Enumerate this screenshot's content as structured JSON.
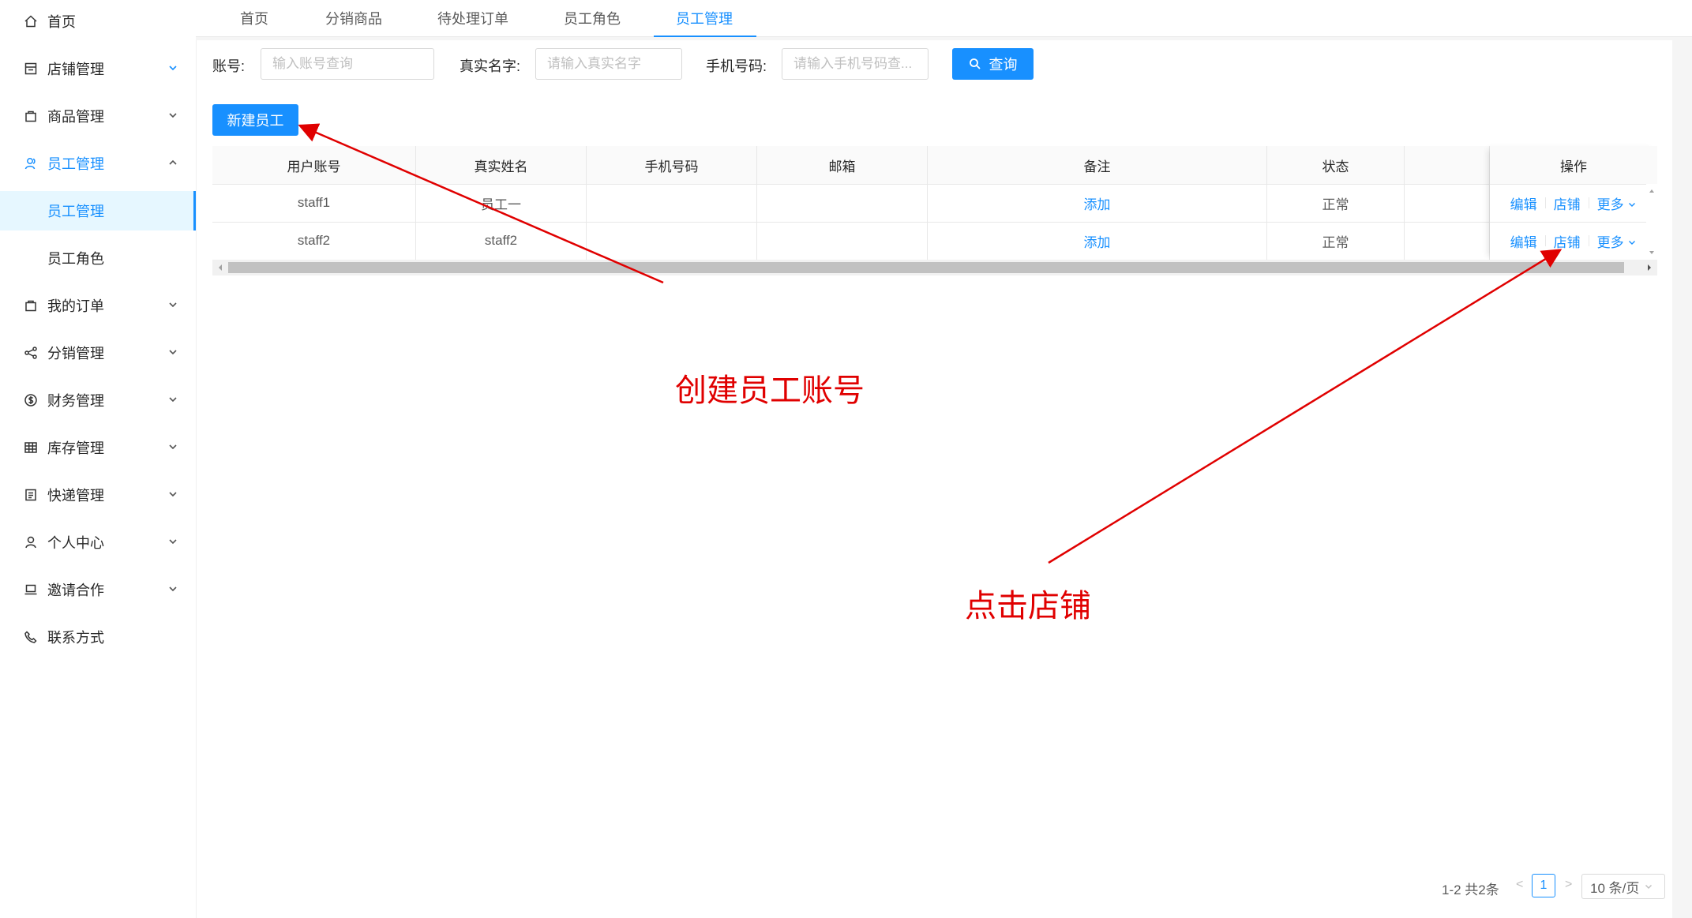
{
  "sidebar": {
    "items": [
      {
        "label": "首页",
        "icon": "home-icon",
        "type": "top",
        "expandable": false
      },
      {
        "label": "店铺管理",
        "icon": "store-icon",
        "type": "top",
        "expandable": true,
        "chevron": "down",
        "chevron_color": "#1890ff"
      },
      {
        "label": "商品管理",
        "icon": "shopping-bag-icon",
        "type": "top",
        "expandable": true,
        "chevron": "down"
      },
      {
        "label": "员工管理",
        "icon": "team-icon",
        "type": "top",
        "expandable": true,
        "chevron": "up",
        "open": true
      },
      {
        "label": "员工管理",
        "type": "sub",
        "active": true
      },
      {
        "label": "员工角色",
        "type": "sub"
      },
      {
        "label": "我的订单",
        "icon": "shopping-bag-icon",
        "type": "top",
        "expandable": true,
        "chevron": "down"
      },
      {
        "label": "分销管理",
        "icon": "share-icon",
        "type": "top",
        "expandable": true,
        "chevron": "down"
      },
      {
        "label": "财务管理",
        "icon": "dollar-icon",
        "type": "top",
        "expandable": true,
        "chevron": "down"
      },
      {
        "label": "库存管理",
        "icon": "table-icon",
        "type": "top",
        "expandable": true,
        "chevron": "down"
      },
      {
        "label": "快递管理",
        "icon": "list-icon",
        "type": "top",
        "expandable": true,
        "chevron": "down"
      },
      {
        "label": "个人中心",
        "icon": "user-icon",
        "type": "top",
        "expandable": true,
        "chevron": "down"
      },
      {
        "label": "邀请合作",
        "icon": "laptop-icon",
        "type": "top",
        "expandable": true,
        "chevron": "down"
      },
      {
        "label": "联系方式",
        "icon": "phone-icon",
        "type": "top",
        "expandable": false
      }
    ]
  },
  "tabs": [
    {
      "label": "首页",
      "active": false
    },
    {
      "label": "分销商品",
      "active": false
    },
    {
      "label": "待处理订单",
      "active": false
    },
    {
      "label": "员工角色",
      "active": false
    },
    {
      "label": "员工管理",
      "active": true
    }
  ],
  "search": {
    "account_label": "账号:",
    "account_placeholder": "输入账号查询",
    "realname_label": "真实名字:",
    "realname_placeholder": "请输入真实名字",
    "phone_label": "手机号码:",
    "phone_placeholder": "请输入手机号码查...",
    "query_button": "查询"
  },
  "new_staff_button": "新建员工",
  "table": {
    "columns": [
      "用户账号",
      "真实姓名",
      "手机号码",
      "邮箱",
      "备注",
      "状态",
      "",
      "操作"
    ],
    "rows": [
      {
        "account": "staff1",
        "realname": "员工一",
        "phone": "",
        "email": "",
        "remark": "添加",
        "status": "正常"
      },
      {
        "account": "staff2",
        "realname": "staff2",
        "phone": "",
        "email": "",
        "remark": "添加",
        "status": "正常"
      }
    ],
    "actions": {
      "edit": "编辑",
      "store": "店铺",
      "more": "更多"
    }
  },
  "pagination": {
    "total_text": "1-2 共2条",
    "current_page": "1",
    "page_size": "10 条/页"
  },
  "annotations": {
    "create_account": "创建员工账号",
    "click_store": "点击店铺",
    "color": "#e00000"
  },
  "colors": {
    "primary": "#1890ff",
    "active_bg": "#e6f7ff"
  }
}
